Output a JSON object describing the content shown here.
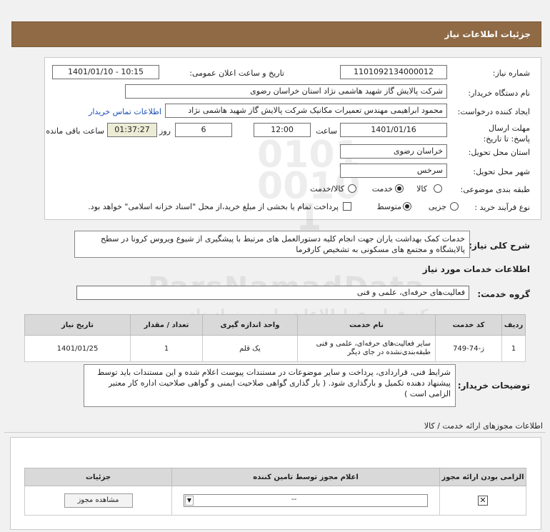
{
  "page_title": "جزئیات اطلاعات نیاز",
  "labels": {
    "need_number": "شماره نیاز:",
    "announce_datetime": "تاریخ و ساعت اعلان عمومی:",
    "buyer_org": "نام دستگاه خریدار:",
    "requester": "ایجاد کننده درخواست:",
    "contact_link": "اطلاعات تماس خریدار",
    "deadline": "مهلت ارسال پاسخ: تا تاریخ:",
    "time": "ساعت",
    "day_and": "روز و",
    "remaining": "ساعت باقی مانده",
    "province": "استان محل تحویل:",
    "city": "شهر محل تحویل:",
    "category": "طبقه بندی موضوعی:",
    "process_type": "نوع فرآیند خرید :",
    "general_desc": "شرح کلی نیاز:",
    "services_info": "اطلاعات خدمات مورد نیاز",
    "service_group": "گروه خدمت:",
    "buyer_notes": "توضیحات خریدار:",
    "permits_info": "اطلاعات مجوزهای ارائه خدمت / کالا"
  },
  "values": {
    "need_number": "1101092134000012",
    "announce_datetime": "1401/01/10 - 10:15",
    "buyer_org": "شرکت پالایش گاز شهید هاشمی نژاد   استان خراسان رضوی",
    "requester": "محمود ابراهیمی مهندس تعمیرات مکانیک شرکت پالایش گاز شهید هاشمی نژاد",
    "deadline_date": "1401/01/16",
    "deadline_time": "12:00",
    "days": "6",
    "remaining_time": "01:37:27",
    "province": "خراسان رضوی",
    "city": "سرخس",
    "general_desc": "خدمات کمک بهداشت یاران  جهت انجام کلیه دستورالعمل های مرتبط با پیشگیری از شیوع ویروس کرونا  در سطح پالایشگاه و مجتمع های مسکونی  به تشخیص کارفرما",
    "service_group": "فعالیت‌های حرفه‌ای، علمی و فنی",
    "buyer_notes": "شرایط فنی، قراردادی، پرداخت و سایر موضوعات در مستندات پیوست اعلام شده و این مستندات باید توسط پیشنهاد دهنده تکمیل و  بارگذاری شود. ( بار گذاری گواهی صلاحیت ایمنی و گواهی صلاحیت اداره کار معتبر الزامی است )"
  },
  "category_options": [
    {
      "label": "کالا",
      "selected": false
    },
    {
      "label": "خدمت",
      "selected": true
    },
    {
      "label": "کالا/خدمت",
      "selected": false
    }
  ],
  "process_options": [
    {
      "label": "جزیی",
      "selected": false
    },
    {
      "label": "متوسط",
      "selected": true
    }
  ],
  "process_note": "پرداخت تمام یا بخشی از مبلغ خرید،از محل \"اسناد خزانه اسلامی\" خواهد بود.",
  "items_table": {
    "headers": [
      "ردیف",
      "کد خدمت",
      "نام خدمت",
      "واحد اندازه گیری",
      "تعداد / مقدار",
      "تاریخ نیاز"
    ],
    "rows": [
      [
        "1",
        "ز-74-749",
        "سایر فعالیت‌های حرفه‌ای، علمی و فنی طبقه‌بندی‌نشده در جای دیگر",
        "یک قلم",
        "1",
        "1401/01/25"
      ]
    ]
  },
  "permits_table": {
    "headers": [
      "الزامی بودن ارائه مجوز",
      "اعلام مجوز توسط تامین کننده",
      "جزئیات"
    ],
    "select_value": "--",
    "view_button": "مشاهده مجوز"
  },
  "watermark": {
    "brand": "ParsNamadData",
    "line1": "مرکز فراوری اطلاعات پارس نماد داده",
    "line2": "پایگاه تخصصی مناقصه و مزایده"
  }
}
